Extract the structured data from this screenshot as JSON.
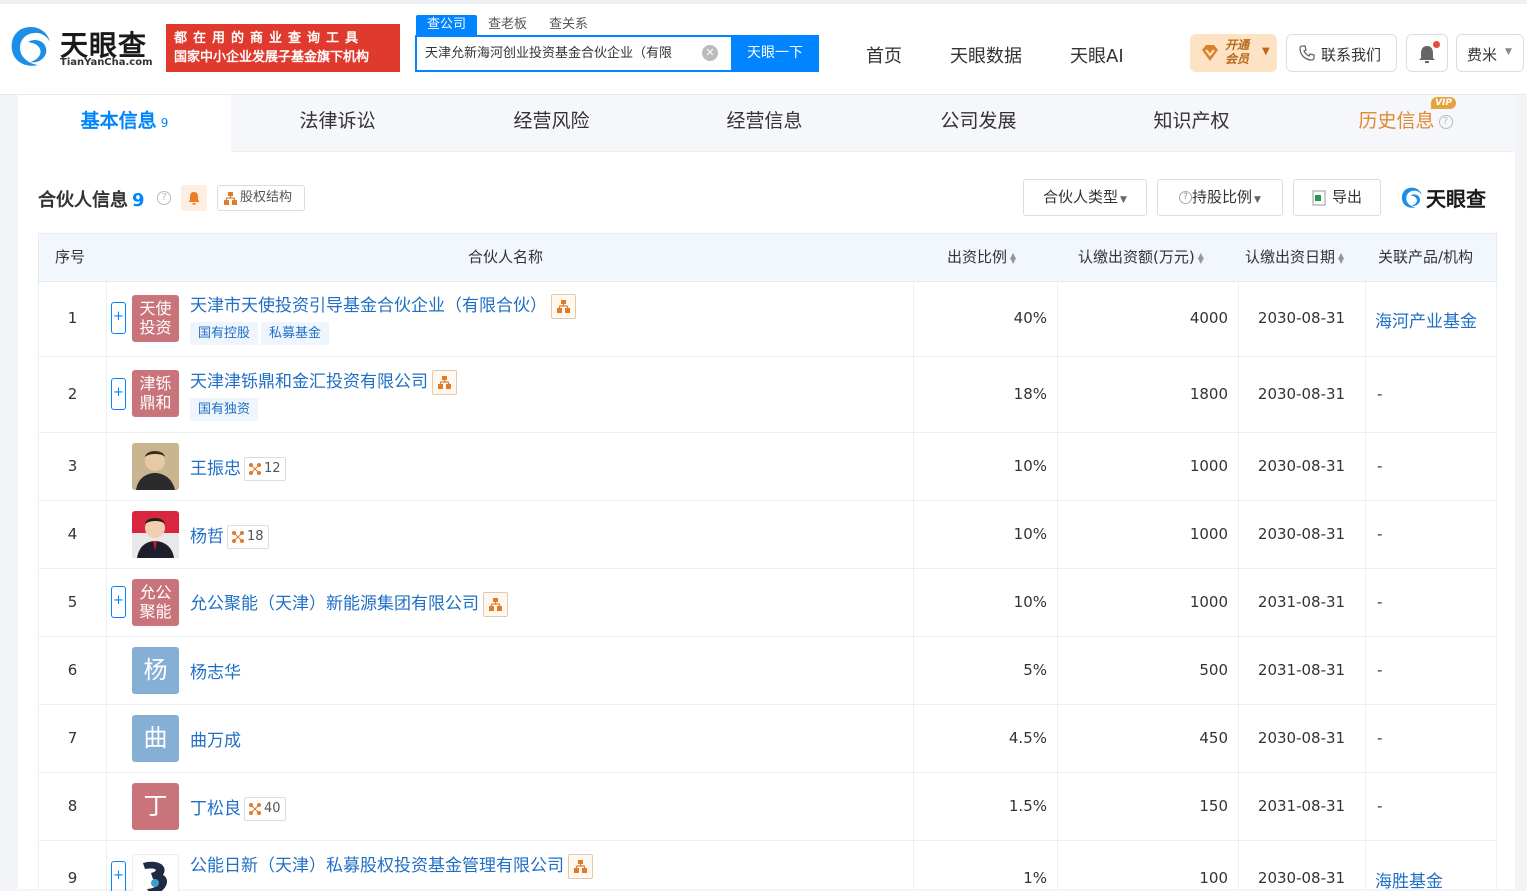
{
  "header": {
    "logo_text": "天眼查",
    "logo_domain": "TianYanCha.com",
    "slogan_line1": "都在用的商业查询工具",
    "slogan_line2": "国家中小企业发展子基金旗下机构",
    "search_tabs": [
      "查公司",
      "查老板",
      "查关系"
    ],
    "search_value": "天津允新海河创业投资基金合伙企业（有限",
    "search_button": "天眼一下",
    "nav": [
      "首页",
      "天眼数据",
      "天眼AI"
    ],
    "vip_line1": "开通",
    "vip_line2": "会员",
    "contact": "联系我们",
    "user": "费米"
  },
  "tabs": [
    {
      "label": "基本信息",
      "count": "9"
    },
    {
      "label": "法律诉讼"
    },
    {
      "label": "经营风险"
    },
    {
      "label": "经营信息"
    },
    {
      "label": "公司发展"
    },
    {
      "label": "知识产权"
    },
    {
      "label": "历史信息",
      "badge": "VIP"
    }
  ],
  "section": {
    "title": "合伙人信息",
    "count": "9",
    "equity_button": "股权结构",
    "filter_type": "合伙人类型",
    "filter_ratio": "持股比例",
    "export": "导出",
    "brand": "天眼查"
  },
  "table": {
    "headers": {
      "index": "序号",
      "name": "合伙人名称",
      "ratio": "出资比例",
      "amount": "认缴出资额(万元)",
      "date": "认缴出资日期",
      "related": "关联产品/机构"
    },
    "rows": [
      {
        "index": "1",
        "avatar": "天使投资",
        "name": "天津市天使投资引导基金合伙企业（有限合伙）",
        "tags": [
          "国有控股",
          "私募基金"
        ],
        "ratio": "40%",
        "amount": "4000",
        "date": "2030-08-31",
        "related": "海河产业基金"
      },
      {
        "index": "2",
        "avatar": "津铄鼎和",
        "name": "天津津铄鼎和金汇投资有限公司",
        "tags": [
          "国有独资"
        ],
        "ratio": "18%",
        "amount": "1800",
        "date": "2030-08-31",
        "related": "-"
      },
      {
        "index": "3",
        "avatar": "",
        "name": "王振忠",
        "rel_count": "12",
        "ratio": "10%",
        "amount": "1000",
        "date": "2030-08-31",
        "related": "-"
      },
      {
        "index": "4",
        "avatar": "",
        "name": "杨哲",
        "rel_count": "18",
        "ratio": "10%",
        "amount": "1000",
        "date": "2030-08-31",
        "related": "-"
      },
      {
        "index": "5",
        "avatar": "允公聚能",
        "name": "允公聚能（天津）新能源集团有限公司",
        "ratio": "10%",
        "amount": "1000",
        "date": "2031-08-31",
        "related": "-"
      },
      {
        "index": "6",
        "avatar": "杨",
        "name": "杨志华",
        "ratio": "5%",
        "amount": "500",
        "date": "2031-08-31",
        "related": "-"
      },
      {
        "index": "7",
        "avatar": "曲",
        "name": "曲万成",
        "ratio": "4.5%",
        "amount": "450",
        "date": "2030-08-31",
        "related": "-"
      },
      {
        "index": "8",
        "avatar": "丁",
        "name": "丁松良",
        "rel_count": "40",
        "ratio": "1.5%",
        "amount": "150",
        "date": "2031-08-31",
        "related": "-"
      },
      {
        "index": "9",
        "avatar": "",
        "name": "公能日新（天津）私募股权投资基金管理有限公司",
        "ratio": "1%",
        "amount": "100",
        "date": "2030-08-31",
        "related": "海胜基金"
      }
    ]
  },
  "colors": {
    "accent": "#0084ff",
    "link": "#1f6fc6",
    "slogan_bg": "#e03a2f",
    "avatar_company": "#c8747a",
    "avatar_person_blue": "#86afd6",
    "avatar_person_red": "#c8747a"
  }
}
